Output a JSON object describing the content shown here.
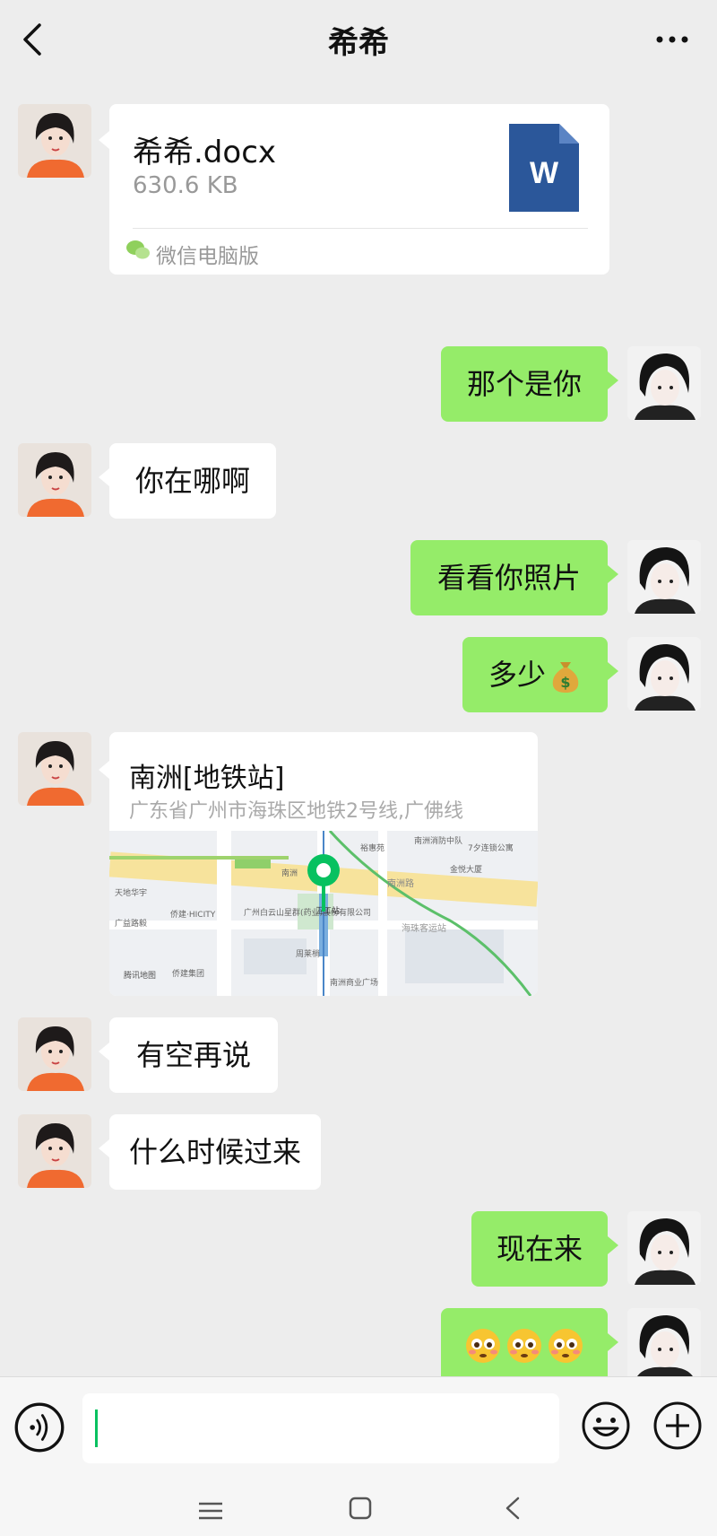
{
  "header": {
    "title": "希希"
  },
  "messages": {
    "file": {
      "name": "希希.docx",
      "size": "630.6 KB",
      "source": "微信电脑版",
      "icon_letter": "W"
    },
    "m1": "那个是你",
    "m2": "你在哪啊",
    "m3": "看看你照片",
    "m4": "多少",
    "location": {
      "name": "南洲[地铁站]",
      "address": "广东省广州市海珠区地铁2号线,广佛线"
    },
    "m5": "有空再说",
    "m6": "什么时候过来",
    "m7": "现在来"
  },
  "map_labels": {
    "l1": "裕惠苑",
    "l2": "南洲消防中队",
    "l3": "7夕连锁公寓",
    "l4": "金悦大厦",
    "l5": "天地华宇",
    "l6": "侨建·HICITY",
    "l7": "广州白云山星群(药业)股份有限公司",
    "l8": "广益路毅",
    "l9": "南洲路",
    "l10": "海珠客运站",
    "l11": "周莱梢",
    "l12": "南洲商业广场",
    "l13": "侨建集团",
    "l14": "腾讯地图",
    "l15": "南洲",
    "l16": "卫工站"
  },
  "input": {
    "placeholder": ""
  },
  "icons": {
    "back": "chevron-left-icon",
    "more": "more-icon",
    "voice": "voice-icon",
    "emoji": "emoji-icon",
    "plus": "plus-icon",
    "word": "word-file-icon",
    "pin": "map-pin-icon"
  },
  "colors": {
    "background": "#ededed",
    "bubble_out": "#95ec69",
    "bubble_in": "#ffffff",
    "pin": "#07c160",
    "word": "#2b579a"
  }
}
